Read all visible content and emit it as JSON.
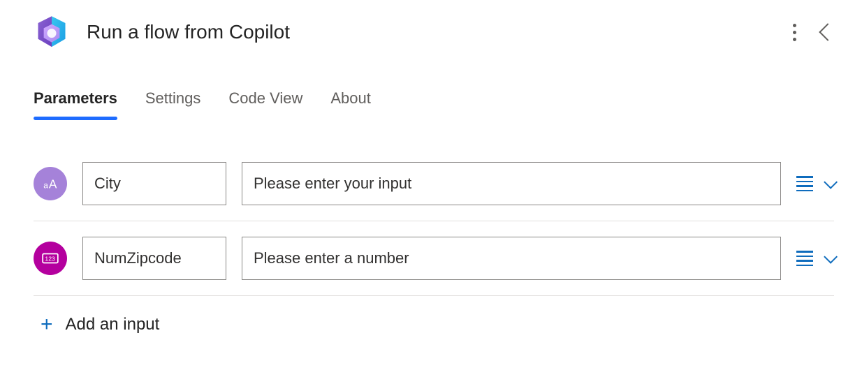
{
  "header": {
    "title": "Run a flow from Copilot"
  },
  "tabs": [
    {
      "label": "Parameters",
      "active": true
    },
    {
      "label": "Settings",
      "active": false
    },
    {
      "label": "Code View",
      "active": false
    },
    {
      "label": "About",
      "active": false
    }
  ],
  "parameters": [
    {
      "type": "text",
      "name": "City",
      "placeholder": "Please enter your input"
    },
    {
      "type": "number",
      "name": "NumZipcode",
      "placeholder": "Please enter a number"
    }
  ],
  "addInput": {
    "label": "Add an input"
  },
  "colors": {
    "accent": "#0f6cbd",
    "tabActive": "#1e6cff",
    "textBadge": "#a582d9",
    "numberBadge": "#b4009e"
  }
}
